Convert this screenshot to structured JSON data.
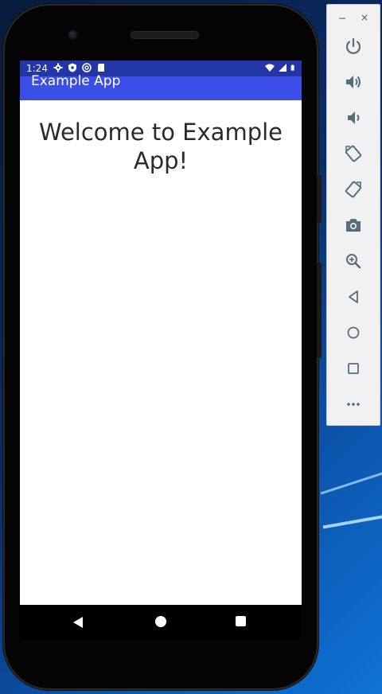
{
  "status_bar": {
    "time": "1:24",
    "left_icons": [
      "gear-icon",
      "shield-icon",
      "at-sign-icon",
      "sd-card-icon"
    ],
    "right_icons": [
      "wifi-icon",
      "cell-signal-icon",
      "battery-icon"
    ]
  },
  "app_bar": {
    "title": "Example App"
  },
  "content": {
    "welcome": "Welcome to Example App!"
  },
  "nav_bar": {
    "buttons": [
      "back",
      "home",
      "recents"
    ]
  },
  "emulator_panel": {
    "window_controls": {
      "minimize": "−",
      "close": "×"
    },
    "controls": [
      "power-icon",
      "volume-up-icon",
      "volume-down-icon",
      "rotate-left-icon",
      "rotate-right-icon",
      "camera-icon",
      "zoom-icon",
      "back-icon",
      "home-icon",
      "overview-icon",
      "more-icon"
    ]
  },
  "colors": {
    "status_bar": "#2436a6",
    "app_bar": "#3b4ee8",
    "panel_icon": "#546e7a"
  }
}
